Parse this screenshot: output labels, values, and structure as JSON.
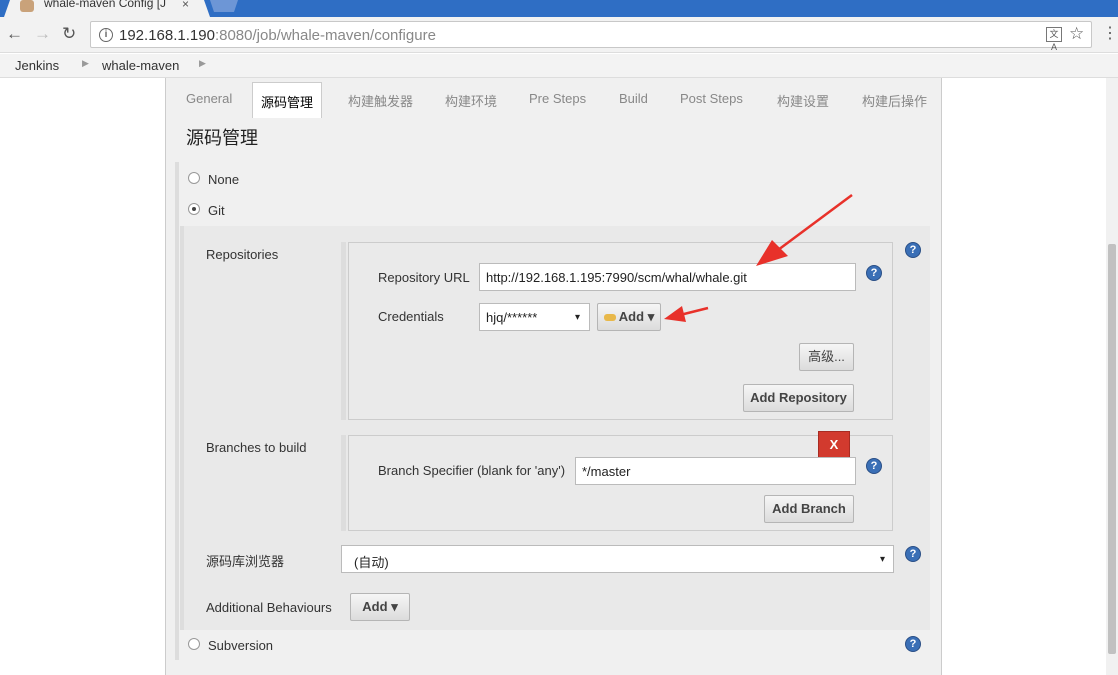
{
  "browser": {
    "tab_title": "whale-maven Config [J",
    "tab_close": "×",
    "url_host": "192.168.1.190",
    "url_rest": ":8080/job/whale-maven/configure",
    "back": "←",
    "forward": "→",
    "reload": "↻",
    "star": "☆",
    "menu": "⋮",
    "translate": "文A",
    "info": "i"
  },
  "breadcrumb": [
    "Jenkins",
    "whale-maven"
  ],
  "tabs": [
    "General",
    "源码管理",
    "构建触发器",
    "构建环境",
    "Pre Steps",
    "Build",
    "Post Steps",
    "构建设置",
    "构建后操作"
  ],
  "section_title": "源码管理",
  "scm": {
    "none_label": "None",
    "git_label": "Git",
    "subversion_label": "Subversion"
  },
  "repositories": {
    "label": "Repositories",
    "url_label": "Repository URL",
    "url_value": "http://192.168.1.195:7990/scm/whal/whale.git",
    "cred_label": "Credentials",
    "cred_value": "hjq/******",
    "add_label": "Add",
    "advanced_label": "高级...",
    "add_repo_label": "Add Repository"
  },
  "branches": {
    "label": "Branches to build",
    "spec_label": "Branch Specifier (blank for 'any')",
    "spec_value": "*/master",
    "delete_label": "X",
    "add_branch_label": "Add Branch"
  },
  "browser_field": {
    "label": "源码库浏览器",
    "value": "(自动)"
  },
  "behaviours": {
    "label": "Additional Behaviours",
    "add_label": "Add"
  },
  "help_symbol": "?",
  "icons": {
    "dropdown": "▾"
  },
  "colors": {
    "tabstrip": "#2f6ec4",
    "help": "#3a6fb6",
    "delete": "#d23a2e",
    "arrow": "#e8312a"
  }
}
